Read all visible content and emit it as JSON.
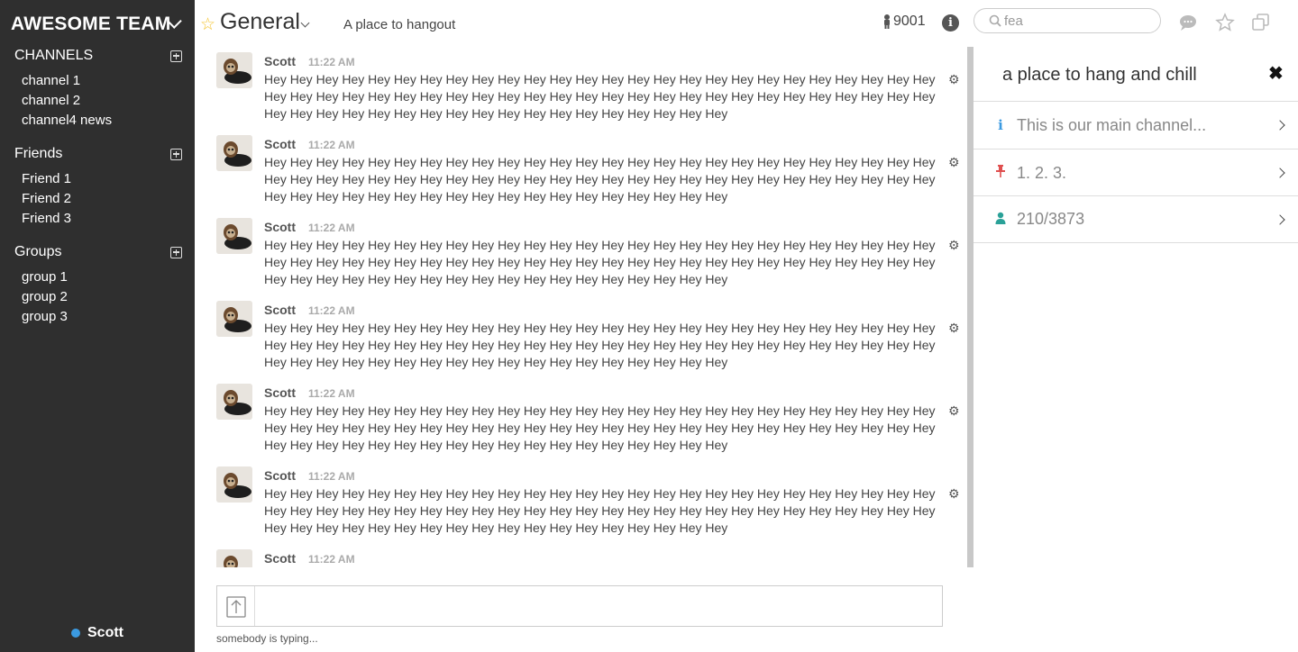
{
  "team": {
    "name": "AWESOME TEAM"
  },
  "sidebar": {
    "sections": [
      {
        "title": "CHANNELS",
        "items": [
          "channel 1",
          "channel 2",
          "channel4 news"
        ]
      },
      {
        "title": "Friends",
        "items": [
          "Friend 1",
          "Friend 2",
          "Friend 3"
        ]
      },
      {
        "title": "Groups",
        "items": [
          "group 1",
          "group 2",
          "group 3"
        ]
      }
    ],
    "current_user": "Scott",
    "status_color": "#3b9ae1"
  },
  "header": {
    "channel_name": "General",
    "description": "A place to hangout",
    "member_count": "9001",
    "search_value": "fea"
  },
  "messages": [
    {
      "author": "Scott",
      "time": "11:22 AM",
      "text": "Hey Hey Hey Hey Hey Hey Hey Hey Hey Hey Hey Hey Hey Hey Hey Hey Hey Hey Hey Hey Hey Hey Hey Hey Hey Hey Hey Hey Hey Hey Hey Hey Hey Hey Hey Hey Hey Hey Hey Hey Hey Hey Hey Hey Hey Hey Hey Hey Hey Hey Hey Hey Hey Hey Hey Hey Hey Hey Hey Hey Hey Hey Hey Hey Hey Hey Hey Hey Hey Hey"
    },
    {
      "author": "Scott",
      "time": "11:22 AM",
      "text": "Hey Hey Hey Hey Hey Hey Hey Hey Hey Hey Hey Hey Hey Hey Hey Hey Hey Hey Hey Hey Hey Hey Hey Hey Hey Hey Hey Hey Hey Hey Hey Hey Hey Hey Hey Hey Hey Hey Hey Hey Hey Hey Hey Hey Hey Hey Hey Hey Hey Hey Hey Hey Hey Hey Hey Hey Hey Hey Hey Hey Hey Hey Hey Hey Hey Hey Hey Hey Hey Hey"
    },
    {
      "author": "Scott",
      "time": "11:22 AM",
      "text": "Hey Hey Hey Hey Hey Hey Hey Hey Hey Hey Hey Hey Hey Hey Hey Hey Hey Hey Hey Hey Hey Hey Hey Hey Hey Hey Hey Hey Hey Hey Hey Hey Hey Hey Hey Hey Hey Hey Hey Hey Hey Hey Hey Hey Hey Hey Hey Hey Hey Hey Hey Hey Hey Hey Hey Hey Hey Hey Hey Hey Hey Hey Hey Hey Hey Hey Hey Hey Hey Hey"
    },
    {
      "author": "Scott",
      "time": "11:22 AM",
      "text": "Hey Hey Hey Hey Hey Hey Hey Hey Hey Hey Hey Hey Hey Hey Hey Hey Hey Hey Hey Hey Hey Hey Hey Hey Hey Hey Hey Hey Hey Hey Hey Hey Hey Hey Hey Hey Hey Hey Hey Hey Hey Hey Hey Hey Hey Hey Hey Hey Hey Hey Hey Hey Hey Hey Hey Hey Hey Hey Hey Hey Hey Hey Hey Hey Hey Hey Hey Hey Hey Hey"
    },
    {
      "author": "Scott",
      "time": "11:22 AM",
      "text": "Hey Hey Hey Hey Hey Hey Hey Hey Hey Hey Hey Hey Hey Hey Hey Hey Hey Hey Hey Hey Hey Hey Hey Hey Hey Hey Hey Hey Hey Hey Hey Hey Hey Hey Hey Hey Hey Hey Hey Hey Hey Hey Hey Hey Hey Hey Hey Hey Hey Hey Hey Hey Hey Hey Hey Hey Hey Hey Hey Hey Hey Hey Hey Hey Hey Hey Hey Hey Hey Hey"
    },
    {
      "author": "Scott",
      "time": "11:22 AM",
      "text": "Hey Hey Hey Hey Hey Hey Hey Hey Hey Hey Hey Hey Hey Hey Hey Hey Hey Hey Hey Hey Hey Hey Hey Hey Hey Hey Hey Hey Hey Hey Hey Hey Hey Hey Hey Hey Hey Hey Hey Hey Hey Hey Hey Hey Hey Hey Hey Hey Hey Hey Hey Hey Hey Hey Hey Hey Hey Hey Hey Hey Hey Hey Hey Hey Hey Hey Hey Hey Hey Hey"
    },
    {
      "author": "Scott",
      "time": "11:22 AM",
      "text": ""
    }
  ],
  "composer": {
    "typing_status": "somebody is typing..."
  },
  "panel": {
    "title": "a place to hang and chill",
    "items": [
      {
        "icon": "info-icon",
        "label": "This is our main channel...",
        "color": "#3b9ae1"
      },
      {
        "icon": "pin-icon",
        "label": "1. 2. 3.",
        "color": "#e05050"
      },
      {
        "icon": "user-icon",
        "label": "210/3873",
        "color": "#2aa198"
      }
    ]
  }
}
